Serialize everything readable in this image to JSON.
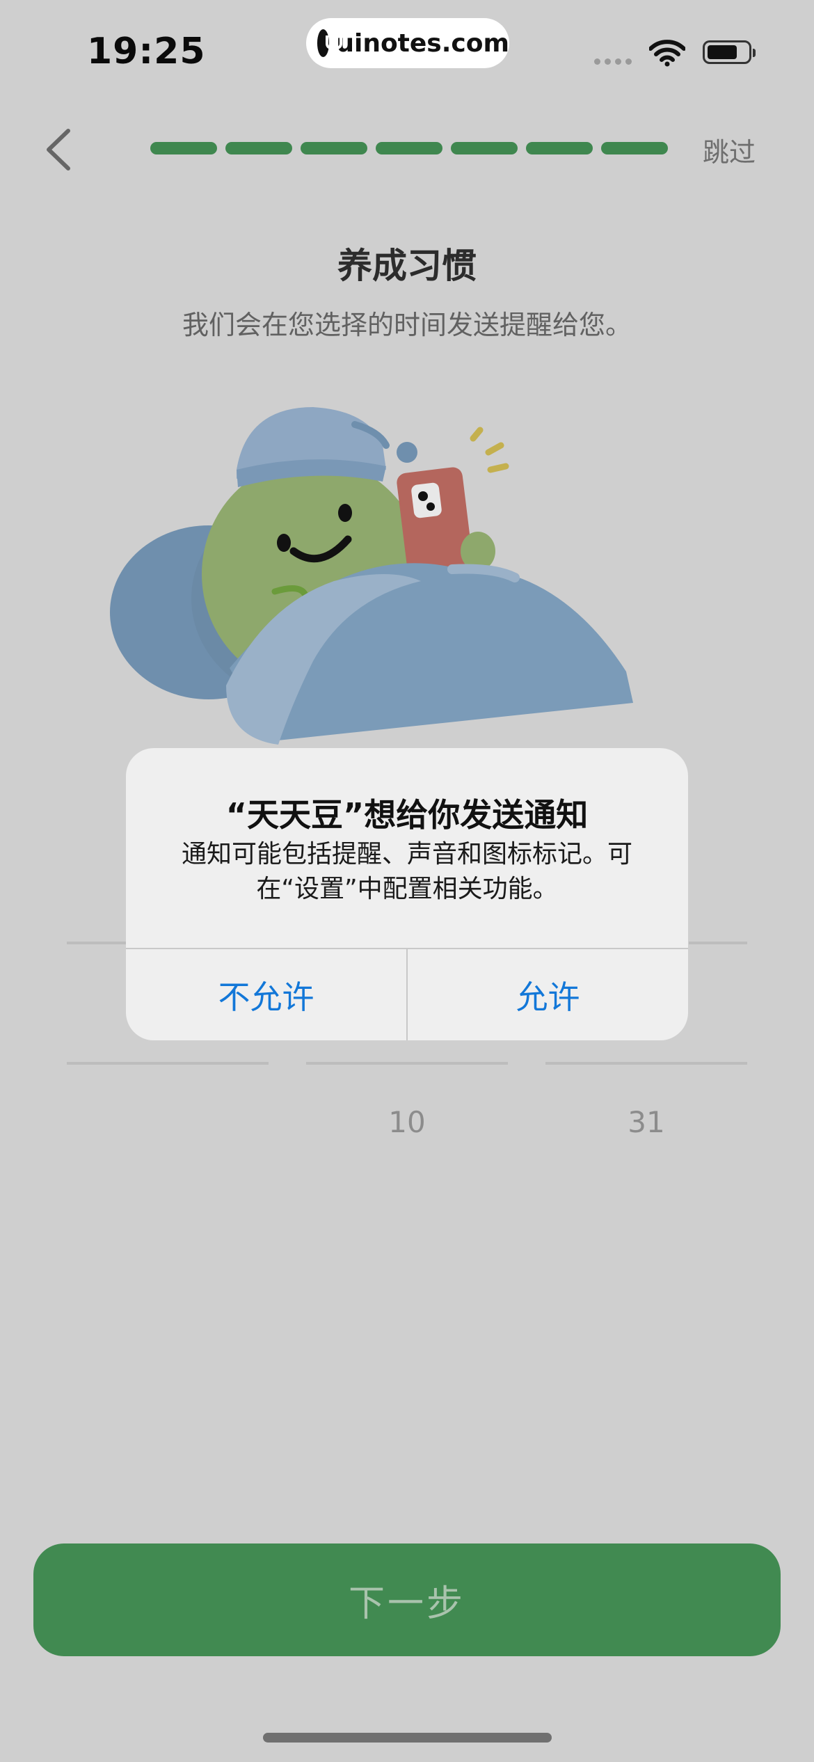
{
  "status_bar": {
    "time": "19:25",
    "watermark": "uinotes.com"
  },
  "nav": {
    "back_icon": "chevron-left-icon",
    "skip_label": "跳过",
    "progress_steps": 7,
    "accent": "#3f874f"
  },
  "onboarding": {
    "title": "养成习惯",
    "subtitle": "我们会在您选择的时间发送提醒给您。"
  },
  "picker": {
    "minute": "10",
    "day": "31"
  },
  "alert": {
    "title": "“天天豆”想给你发送通知",
    "message": "通知可能包括提醒、声音和图标标记。可在“设置”中配置相关功能。",
    "deny_label": "不允许",
    "allow_label": "允许",
    "button_color": "#1277d8"
  },
  "footer": {
    "next_label": "下一步",
    "button_color": "#418a51"
  }
}
